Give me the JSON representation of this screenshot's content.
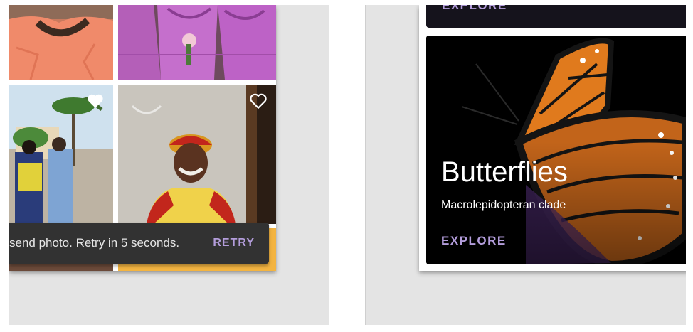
{
  "left_panel": {
    "snackbar": {
      "message": "send photo. Retry in 5 seconds.",
      "action": "RETRY"
    },
    "favorite_icon": "heart-outline-icon"
  },
  "right_panel": {
    "top_card": {
      "action": "EXPLORE"
    },
    "main_card": {
      "title": "Butterflies",
      "subtitle": "Macrolepidopteran clade",
      "action": "EXPLORE"
    }
  },
  "colors": {
    "accent": "#b39ddb",
    "snackbar_bg": "#323232",
    "panel_bg": "#e4e4e4",
    "card_bg": "#000000"
  }
}
